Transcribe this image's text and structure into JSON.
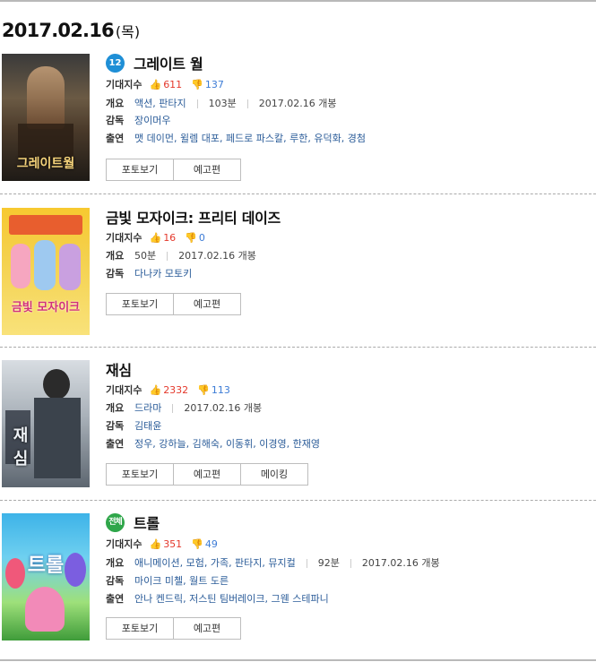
{
  "date": {
    "day": "2017.02.16",
    "dow": "(목)"
  },
  "labels": {
    "expect": "기대지수",
    "overview": "개요",
    "director": "감독",
    "cast": "출연"
  },
  "buttons": {
    "photo": "포토보기",
    "trailer": "예고편",
    "making": "메이킹"
  },
  "movies": [
    {
      "title": "그레이트 월",
      "rating": "12",
      "likes": "611",
      "dislikes": "137",
      "genre": "액션, 판타지",
      "runtime": "103분",
      "release": "2017.02.16 개봉",
      "director": "장이머우",
      "cast": "맷 데이먼, 윌렘 대포, 페드로 파스칼, 루한, 유덕화, 경첨",
      "poster_text": "그레이트월"
    },
    {
      "title": "금빛 모자이크: 프리티 데이즈",
      "likes": "16",
      "dislikes": "0",
      "runtime": "50분",
      "release": "2017.02.16 개봉",
      "director": "다나카 모토키",
      "poster_text": "금빛 모자이크"
    },
    {
      "title": "재심",
      "likes": "2332",
      "dislikes": "113",
      "genre": "드라마",
      "release": "2017.02.16 개봉",
      "director": "김태윤",
      "cast": "정우, 강하늘, 김해숙, 이동휘, 이경영, 한재영",
      "poster_text": "재심"
    },
    {
      "title": "트롤",
      "rating": "전체",
      "likes": "351",
      "dislikes": "49",
      "genre": "애니메이션, 모험, 가족, 판타지, 뮤지컬",
      "runtime": "92분",
      "release": "2017.02.16 개봉",
      "director": "마이크 미첼, 월트 도른",
      "cast": "안나 켄드릭, 저스틴 팀버레이크, 그웬 스테파니",
      "poster_text": "트롤"
    }
  ],
  "colors": {
    "like": "#e4392c",
    "dislike": "#3d7cd6",
    "link": "#2b5c99",
    "rating12": "#1f8fd6",
    "ratingAll": "#2fa64a"
  },
  "icons": {
    "like": "thumbs-up-icon",
    "dislike": "thumbs-down-icon"
  }
}
